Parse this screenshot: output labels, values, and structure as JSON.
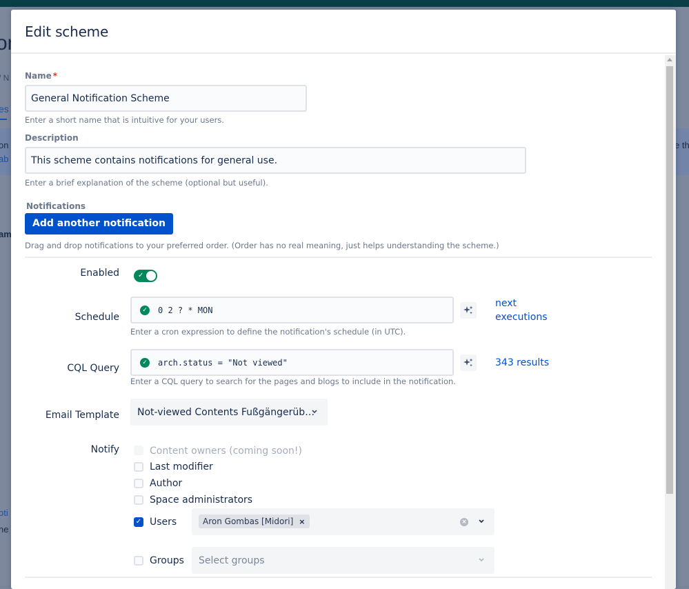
{
  "background": {
    "title_fragment": "on",
    "breadcrumb_fragment": "/ N",
    "tab_fragment": "es",
    "banner_line1_fragment": "on",
    "banner_line2_fragment": "ab",
    "banner_right_fragment": "e th",
    "section_fragment": "am",
    "link_fragment": "oti",
    "text_fragment": "ne c"
  },
  "modal": {
    "title": "Edit scheme",
    "name": {
      "label": "Name",
      "required_marker": "*",
      "value": "General Notification Scheme",
      "helper": "Enter a short name that is intuitive for your users."
    },
    "description": {
      "label": "Description",
      "value": "This scheme contains notifications for general use.",
      "helper": "Enter a brief explanation of the scheme (optional but useful)."
    },
    "notifications": {
      "label": "Notifications",
      "add_button": "Add another notification",
      "helper": "Drag and drop notifications to your preferred order. (Order has no real meaning, just helps understanding the scheme.)"
    },
    "notification": {
      "enabled": {
        "label": "Enabled",
        "value": true
      },
      "schedule": {
        "label": "Schedule",
        "value": "0 2 ? * MON",
        "valid": true,
        "helper": "Enter a cron expression to define the notification's schedule (in UTC).",
        "link_line1": "next",
        "link_line2": "executions"
      },
      "cql": {
        "label": "CQL Query",
        "value": "arch.status = \"Not viewed\"",
        "valid": true,
        "helper": "Enter a CQL query to search for the pages and blogs to include in the notification.",
        "results_link": "343 results"
      },
      "email_template": {
        "label": "Email Template",
        "selected": "Not-viewed Contents Fußgängerüb…"
      },
      "notify": {
        "label": "Notify",
        "options": [
          {
            "label": "Content owners (coming soon!)",
            "checked": false,
            "disabled": true
          },
          {
            "label": "Last modifier",
            "checked": false,
            "disabled": false
          },
          {
            "label": "Author",
            "checked": false,
            "disabled": false
          },
          {
            "label": "Space administrators",
            "checked": false,
            "disabled": false
          }
        ],
        "users": {
          "label": "Users",
          "checked": true,
          "selected": [
            "Aron Gombas [Midori]"
          ]
        },
        "groups": {
          "label": "Groups",
          "checked": false,
          "placeholder": "Select groups"
        }
      }
    }
  },
  "colors": {
    "primary": "#0052cc",
    "success": "#00875a",
    "required": "#de350b"
  }
}
